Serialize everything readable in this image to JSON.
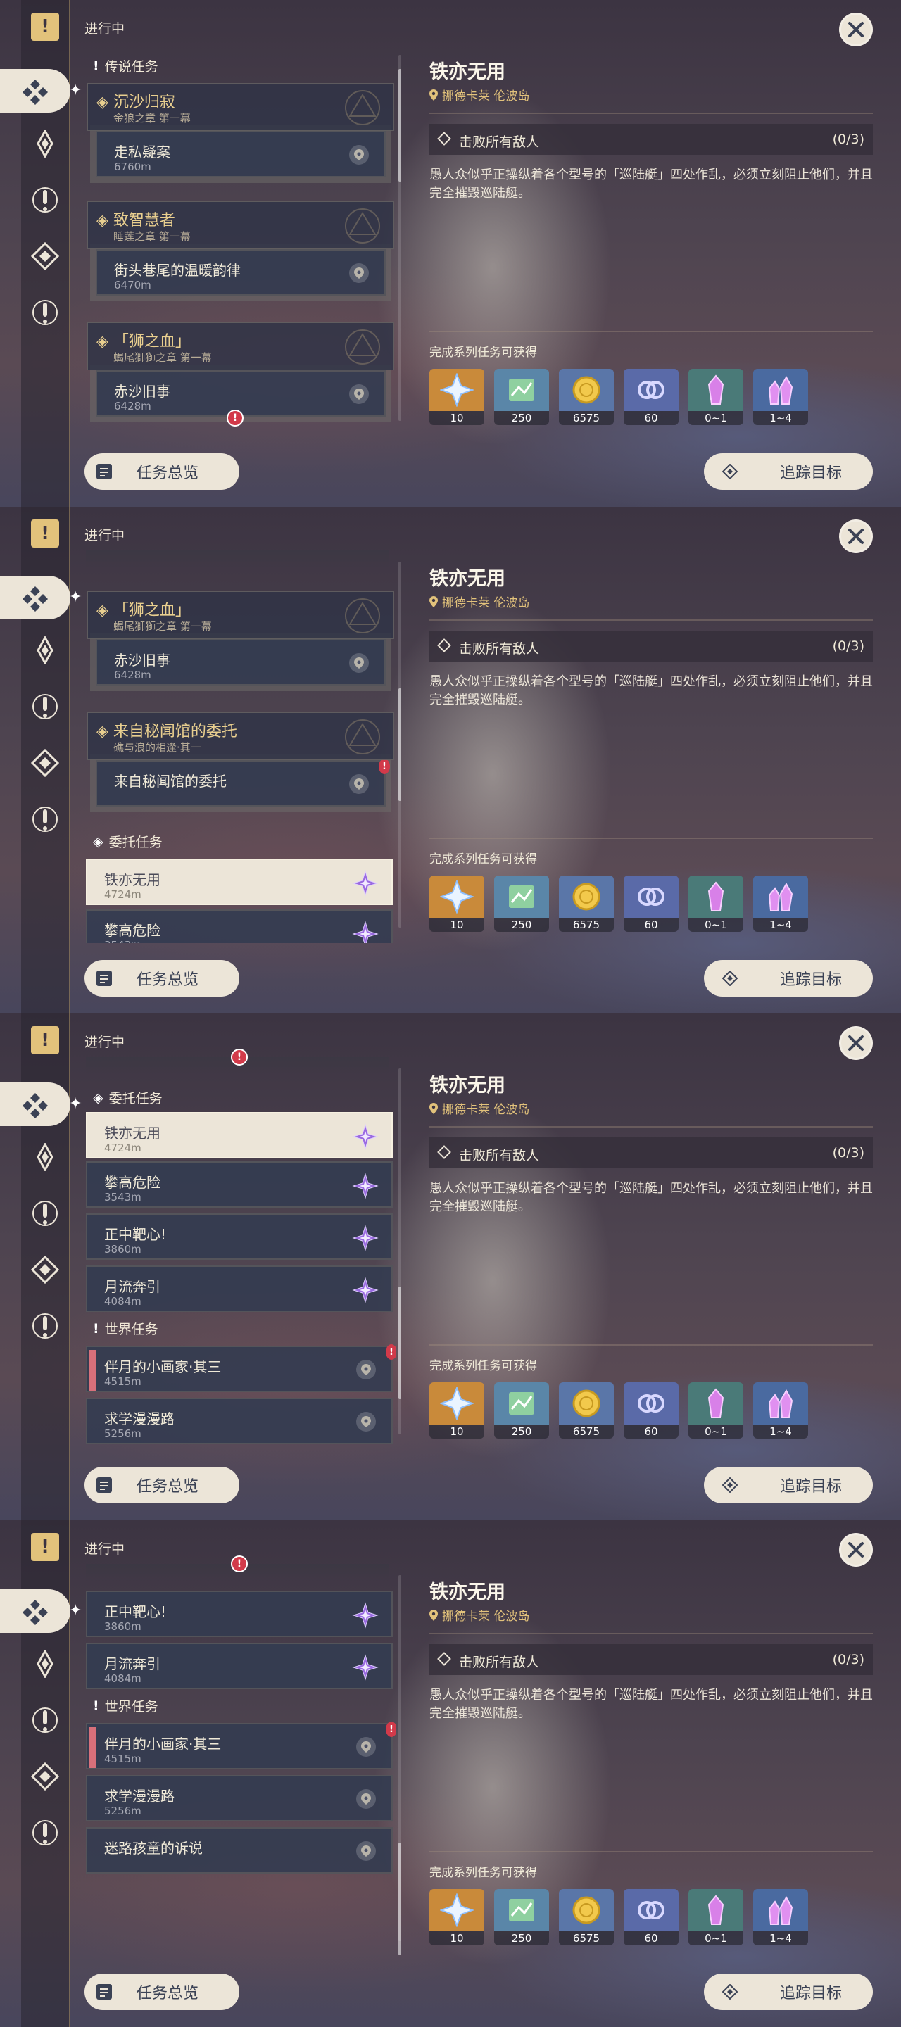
{
  "header": {
    "title": "进行中"
  },
  "sections": {
    "legend": "传说任务",
    "commission": "委托任务",
    "world": "世界任务"
  },
  "chains": {
    "c1": {
      "title": "沉沙归寂",
      "subtitle": "金狼之章 第一幕"
    },
    "c2": {
      "title": "致智慧者",
      "subtitle": "睡莲之章 第一幕"
    },
    "c3": {
      "title": "「狮之血」",
      "subtitle": "蝎尾獅獅之章 第一幕"
    },
    "c4": {
      "title": "来自秘闻馆的委托",
      "subtitle": "礁与浪的相逢·其一"
    }
  },
  "quests": {
    "q1": {
      "title": "走私疑案",
      "dist": "6760m"
    },
    "q2": {
      "title": "街头巷尾的温暖韵律",
      "dist": "6470m"
    },
    "q3": {
      "title": "赤沙旧事",
      "dist": "6428m"
    },
    "q4": {
      "title": "来自秘闻馆的委托",
      "dist": ""
    },
    "q5": {
      "title": "铁亦无用",
      "dist": "4724m"
    },
    "q6": {
      "title": "攀高危险",
      "dist": "3543m"
    },
    "q7": {
      "title": "正中靶心!",
      "dist": "3860m"
    },
    "q8": {
      "title": "月流奔引",
      "dist": "4084m"
    },
    "q9": {
      "title": "伴月的小画家·其三",
      "dist": "4515m"
    },
    "q10": {
      "title": "求学漫漫路",
      "dist": "5256m"
    },
    "q11": {
      "title": "迷路孩童的诉说",
      "dist": ""
    }
  },
  "detail": {
    "title": "铁亦无用",
    "location": "挪德卡莱 伦波岛",
    "objective": "击败所有敌人",
    "progress": "(0/3)",
    "description": "愚人众似乎正操纵着各个型号的「巡陆艇」四处作乱，必须立刻阻止他们，并且完全摧毁巡陆艇。",
    "rewards_title": "完成系列任务可获得",
    "rewards": [
      {
        "icon": "primogem-icon",
        "count": "10",
        "bg": "#c98a3a"
      },
      {
        "icon": "adventure-exp-icon",
        "count": "250",
        "bg": "#5a86a8"
      },
      {
        "icon": "mora-icon",
        "count": "6575",
        "bg": "#5a76a8"
      },
      {
        "icon": "companionship-exp-icon",
        "count": "60",
        "bg": "#5a6aa8"
      },
      {
        "icon": "crystal-chunk-icon",
        "count": "0~1",
        "bg": "#4a7a78"
      },
      {
        "icon": "crystal-cluster-icon",
        "count": "1~4",
        "bg": "#4a6aa0"
      }
    ]
  },
  "buttons": {
    "overview": "任务总览",
    "track": "追踪目标"
  },
  "colors": {
    "accent_gold": "#e2c27b",
    "panel_cream": "#ece5d8",
    "alert_red": "#d23a4a",
    "commission_purple": "#8a5ad8"
  }
}
